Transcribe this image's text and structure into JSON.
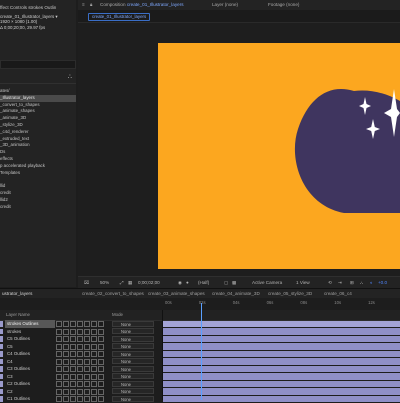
{
  "left_panel": {
    "header": "ffect Controls strokes Outlin",
    "selected_comp": "create_01_Illustrator_layers ▾",
    "comp_info_1": "1920 × 1080 (1.00)",
    "comp_info_2": "Δ 0;00;20;00, 29.97 fps",
    "items": [
      {
        "label": "ates/",
        "selected": false
      },
      {
        "label": "_Illustrator_layers",
        "selected": true
      },
      {
        "label": "_convert_to_shapes",
        "selected": false
      },
      {
        "label": "_animate_shapes",
        "selected": false
      },
      {
        "label": "_animate_3D",
        "selected": false
      },
      {
        "label": "_stylize_3D",
        "selected": false
      },
      {
        "label": "_c4d_renderer",
        "selected": false
      },
      {
        "label": "_extruded_text",
        "selected": false
      },
      {
        "label": "_3D_animation",
        "selected": false
      },
      {
        "label": "Ds",
        "selected": false
      },
      {
        "label": "effects",
        "selected": false
      },
      {
        "label": "p accelerated playback",
        "selected": false
      },
      {
        "label": "Templates",
        "selected": false
      },
      {
        "label": "",
        "selected": false
      },
      {
        "label": "llid",
        "selected": false
      },
      {
        "label": "credit",
        "selected": false
      },
      {
        "label": "llid2",
        "selected": false
      },
      {
        "label": "credit",
        "selected": false
      }
    ]
  },
  "viewer": {
    "tab_comp_label": "Composition",
    "tab_comp_name": "create_01_Illustrator_layers",
    "tab_layer": "Layer (none)",
    "tab_footage": "Footage (none)",
    "comp_pill": "create_01_Illustrator_layers",
    "canvas_color": "#fca71f",
    "egg_color": "#3f355f",
    "sparkle_color": "#ffffff",
    "footer": {
      "zoom": "50%",
      "timecode": "0;00;02;00",
      "resolution": "(Half)",
      "camera": "Active Camera",
      "view": "1 View",
      "offset": "+0.0"
    }
  },
  "timeline": {
    "tabs": [
      {
        "label": "ustrator_layers",
        "active": true
      },
      {
        "label": "create_02_convert_to_shapes",
        "active": false
      },
      {
        "label": "create_03_animate_shapes",
        "active": false
      },
      {
        "label": "create_04_animate_3D",
        "active": false
      },
      {
        "label": "create_05_stylize_3D",
        "active": false
      },
      {
        "label": "create_06_c4",
        "active": false
      }
    ],
    "ruler_ticks": [
      "00s",
      "02s",
      "04s",
      "06s",
      "08s",
      "10s",
      "12s"
    ],
    "header": {
      "layer_name": "Layer Name",
      "mode": "Mode"
    },
    "layers": [
      {
        "name": "strokes Outlines",
        "mode": "None",
        "selected": true
      },
      {
        "name": "strokes",
        "mode": "None",
        "selected": false
      },
      {
        "name": "C5 Outlines",
        "mode": "None",
        "selected": false
      },
      {
        "name": "C5",
        "mode": "None",
        "selected": false
      },
      {
        "name": "C4 Outlines",
        "mode": "None",
        "selected": false
      },
      {
        "name": "C4",
        "mode": "None",
        "selected": false
      },
      {
        "name": "C3 Outlines",
        "mode": "None",
        "selected": false
      },
      {
        "name": "C3",
        "mode": "None",
        "selected": false
      },
      {
        "name": "C2 Outlines",
        "mode": "None",
        "selected": false
      },
      {
        "name": "C2",
        "mode": "None",
        "selected": false
      },
      {
        "name": "C1 Outlines",
        "mode": "None",
        "selected": false
      }
    ]
  }
}
